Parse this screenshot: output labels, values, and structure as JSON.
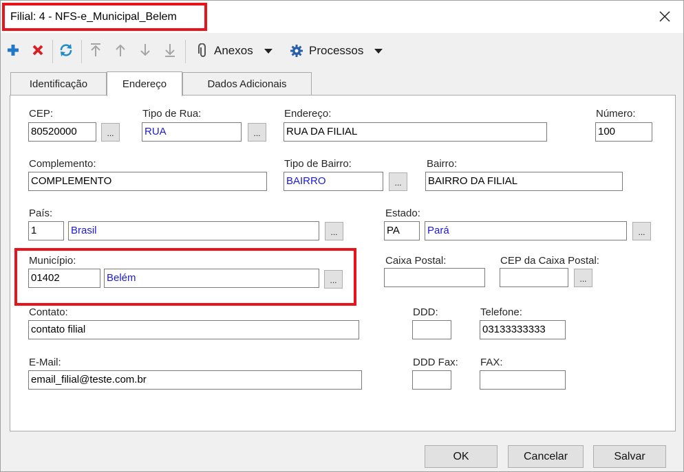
{
  "window": {
    "title": "Filial: 4 - NFS-e_Municipal_Belem"
  },
  "toolbar": {
    "anexos_label": "Anexos",
    "processos_label": "Processos"
  },
  "tabs": [
    {
      "label": "Identificação"
    },
    {
      "label": "Endereço"
    },
    {
      "label": "Dados Adicionais"
    }
  ],
  "form": {
    "cep": {
      "label": "CEP:",
      "value": "80520000"
    },
    "tipo_rua": {
      "label": "Tipo de Rua:",
      "value": "RUA"
    },
    "endereco": {
      "label": "Endereço:",
      "value": "RUA DA FILIAL"
    },
    "numero": {
      "label": "Número:",
      "value": "100"
    },
    "complemento": {
      "label": "Complemento:",
      "value": "COMPLEMENTO"
    },
    "tipo_bairro": {
      "label": "Tipo de Bairro:",
      "value": "BAIRRO"
    },
    "bairro": {
      "label": "Bairro:",
      "value": "BAIRRO DA FILIAL"
    },
    "pais": {
      "label": "País:",
      "code": "1",
      "name": "Brasil"
    },
    "estado": {
      "label": "Estado:",
      "code": "PA",
      "name": "Pará"
    },
    "municipio": {
      "label": "Município:",
      "code": "01402",
      "name": "Belém"
    },
    "caixa_postal": {
      "label": "Caixa Postal:",
      "value": ""
    },
    "cep_caixa_postal": {
      "label": "CEP da Caixa Postal:",
      "value": ""
    },
    "contato": {
      "label": "Contato:",
      "value": "contato filial"
    },
    "ddd": {
      "label": "DDD:",
      "value": ""
    },
    "telefone": {
      "label": "Telefone:",
      "value": "03133333333"
    },
    "email": {
      "label": "E-Mail:",
      "value": "email_filial@teste.com.br"
    },
    "ddd_fax": {
      "label": "DDD Fax:",
      "value": ""
    },
    "fax": {
      "label": "FAX:",
      "value": ""
    },
    "lookup_button_label": "..."
  },
  "buttons": {
    "ok": "OK",
    "cancelar": "Cancelar",
    "salvar": "Salvar"
  },
  "colors": {
    "highlight": "#e8141c",
    "lookup_text": "#1a1ad8"
  }
}
